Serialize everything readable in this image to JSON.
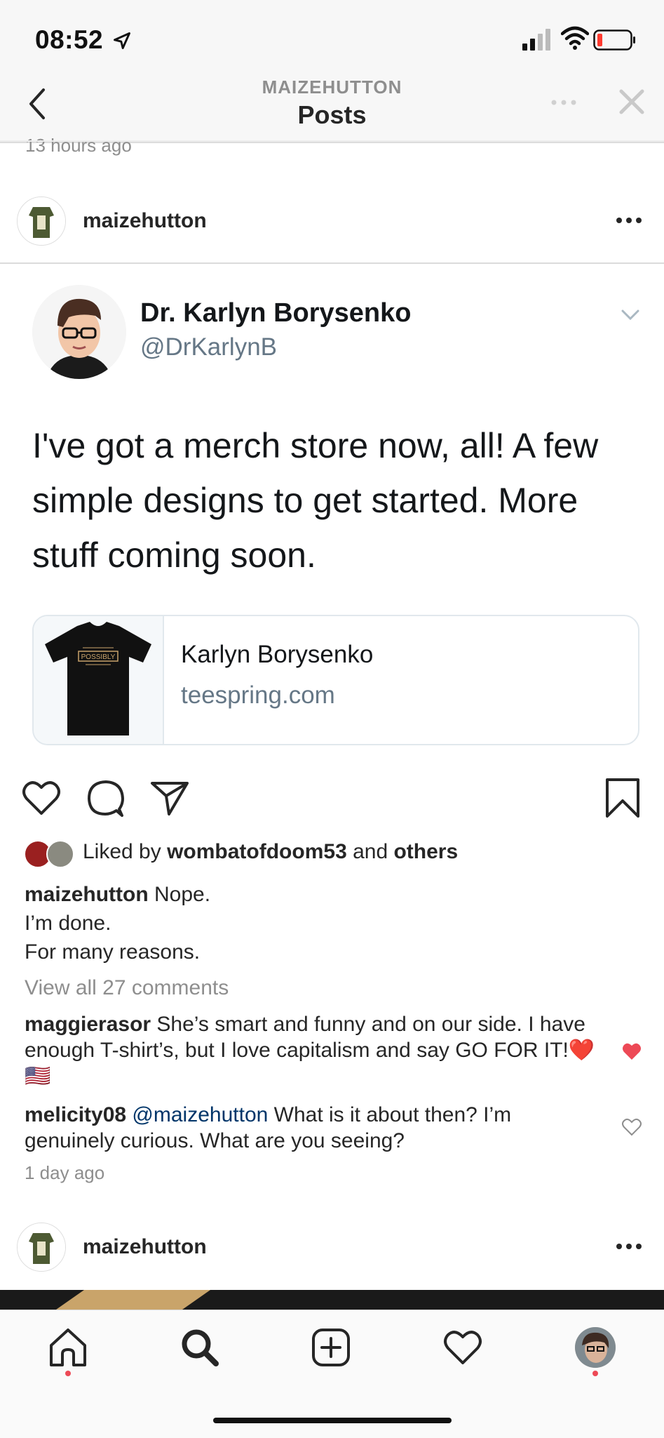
{
  "status_bar": {
    "time": "08:52"
  },
  "header": {
    "account": "MAIZEHUTTON",
    "title": "Posts"
  },
  "previous_post": {
    "time_ago": "13 hours ago"
  },
  "post": {
    "username": "maizehutton",
    "tweet": {
      "name": "Dr. Karlyn Borysenko",
      "handle": "@DrKarlynB",
      "text": "I've got a merch store now, all! A few simple designs to get started. More stuff coming soon.",
      "card_title": "Karlyn Borysenko",
      "card_domain": "teespring.com",
      "shirt_text": "POSSIBLY"
    },
    "likes": {
      "prefix": "Liked by ",
      "user": "wombatofdoom53",
      "middle": " and ",
      "suffix": "others"
    },
    "caption": {
      "user": "maizehutton",
      "line1": " Nope.",
      "line2": "I’m done.",
      "line3": "For many reasons."
    },
    "view_all": "View all 27 comments",
    "comments": [
      {
        "user": "maggierasor",
        "text": " She’s smart and funny and on our side. I have enough T-shirt’s, but I love capitalism and say GO FOR IT!",
        "emoji": "❤️ 🇺🇸",
        "liked": true
      },
      {
        "user": "melicity08",
        "mention": " @maizehutton",
        "text": " What is it about then?  I’m genuinely curious. What are you seeing?",
        "liked": false
      }
    ],
    "time_ago": "1 day ago"
  },
  "next_post": {
    "username": "maizehutton"
  },
  "colors": {
    "like_red": "#ed4956",
    "link": "#003569",
    "muted": "#8e8e8e"
  },
  "icons": [
    "location-arrow-icon",
    "signal-icon",
    "wifi-icon",
    "battery-low-icon",
    "back-chevron-icon",
    "more-icon",
    "close-icon",
    "heart-icon",
    "comment-icon",
    "share-icon",
    "bookmark-icon",
    "home-icon",
    "search-icon",
    "add-post-icon",
    "activity-heart-icon",
    "profile-avatar-icon"
  ]
}
